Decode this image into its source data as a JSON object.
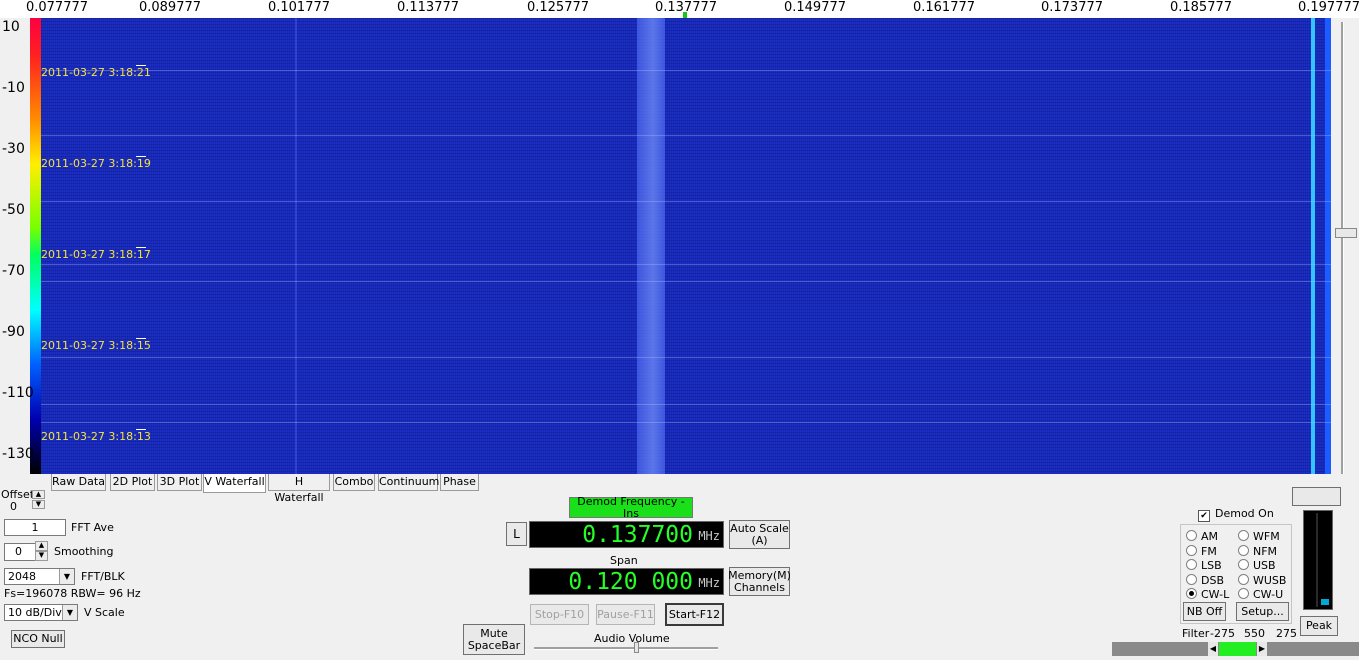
{
  "freq_axis": {
    "ticks": [
      "0.077777",
      "0.089777",
      "0.101777",
      "0.113777",
      "0.125777",
      "0.137777",
      "0.149777",
      "0.161777",
      "0.173777",
      "0.185777",
      "0.197777"
    ]
  },
  "db_scale": {
    "labels": [
      "10",
      "-10",
      "-30",
      "-50",
      "-70",
      "-90",
      "-110",
      "-130"
    ]
  },
  "waterfall": {
    "timestamps": [
      "2011-03-27 3:18:21",
      "2011-03-27 3:18:19",
      "2011-03-27 3:18:17",
      "2011-03-27 3:18:15",
      "2011-03-27 3:18:13"
    ],
    "colors": {
      "background": "#1b2fc8",
      "signal": "#33c4ff",
      "marker": "#19c419",
      "timestamp": "#f5e23a"
    }
  },
  "tabs": [
    {
      "label": "Raw Data",
      "active": false
    },
    {
      "label": "2D Plot",
      "active": false
    },
    {
      "label": "3D Plot",
      "active": false
    },
    {
      "label": "V Waterfall",
      "active": true
    },
    {
      "label": "H Waterfall",
      "active": false
    },
    {
      "label": "Combo",
      "active": false
    },
    {
      "label": "Continuum",
      "active": false
    },
    {
      "label": "Phase",
      "active": false
    }
  ],
  "left_panel": {
    "offset_label": "Offset",
    "offset_value": "0",
    "fft_ave_value": "1",
    "fft_ave_label": "FFT Ave",
    "smoothing_value": "0",
    "smoothing_label": "Smoothing",
    "fft_blk_value": "2048",
    "fft_blk_label": "FFT/BLK",
    "fs_info": "Fs=196078 RBW=  96 Hz",
    "vscale_value": "10 dB/Div",
    "vscale_label": "V Scale",
    "nco_null": "NCO Null"
  },
  "center_panel": {
    "demod_freq_button": "Demod Frequency - Ins",
    "l_button": "L",
    "frequency": "0.137700",
    "freq_unit": "MHz",
    "auto_scale_line1": "Auto Scale",
    "auto_scale_line2": "(A)",
    "span_label": "Span",
    "span": "0.120 000",
    "span_unit": "MHz",
    "memory_line1": "Memory(M)",
    "memory_line2": "Channels",
    "stop": "Stop-F10",
    "pause": "Pause-F11",
    "start": "Start-F12",
    "mute_line1": "Mute",
    "mute_line2": "SpaceBar",
    "audio_volume": "Audio Volume"
  },
  "right_panel": {
    "demod_on": "Demod On",
    "demod_on_checked": true,
    "modes_left": [
      {
        "label": "AM",
        "selected": false
      },
      {
        "label": "FM",
        "selected": false
      },
      {
        "label": "LSB",
        "selected": false
      },
      {
        "label": "DSB",
        "selected": false
      },
      {
        "label": "CW-L",
        "selected": true
      }
    ],
    "modes_right": [
      {
        "label": "WFM",
        "selected": false
      },
      {
        "label": "NFM",
        "selected": false
      },
      {
        "label": "USB",
        "selected": false
      },
      {
        "label": "WUSB",
        "selected": false
      },
      {
        "label": "CW-U",
        "selected": false
      }
    ],
    "nb_off": "NB Off",
    "setup": "Setup...",
    "filter_label": "Filter",
    "filter_low": "-275",
    "filter_width": "550",
    "filter_high": "275",
    "peak": "Peak"
  }
}
